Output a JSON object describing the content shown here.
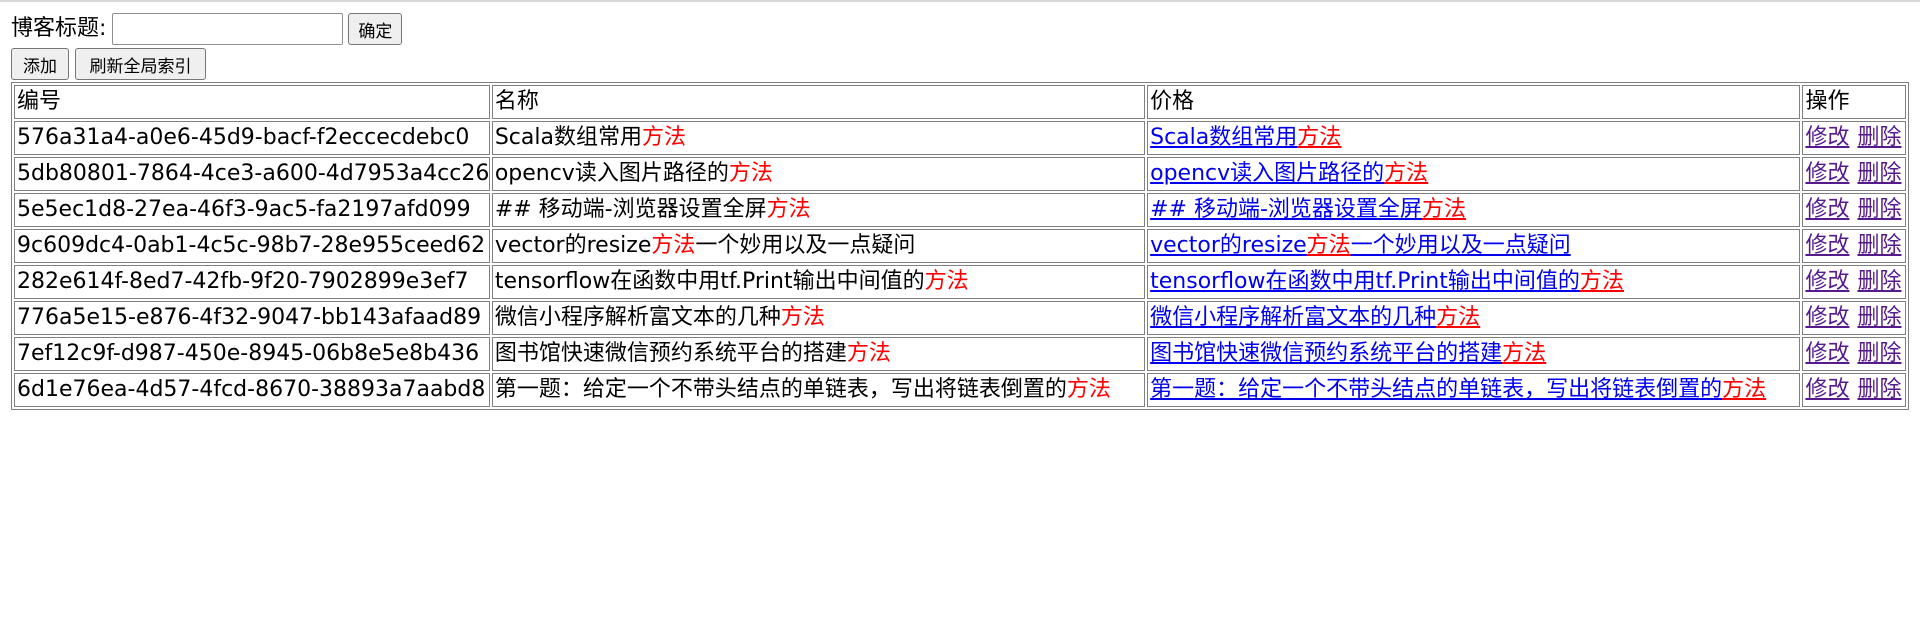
{
  "search": {
    "label": "博客标题:",
    "value": "",
    "placeholder": "",
    "confirm_label": "确定"
  },
  "toolbar": {
    "add_label": "添加",
    "refresh_label": "刷新全局索引"
  },
  "table": {
    "headers": [
      "编号",
      "名称",
      "价格",
      "操作"
    ],
    "rows": [
      {
        "id": "576a31a4-a0e6-45d9-bacf-f2eccecdebc0",
        "pre": "Scala数组常用",
        "hl": "方法",
        "post": ""
      },
      {
        "id": "5db80801-7864-4ce3-a600-4d7953a4cc26",
        "pre": "opencv读入图片路径的",
        "hl": "方法",
        "post": ""
      },
      {
        "id": "5e5ec1d8-27ea-46f3-9ac5-fa2197afd099",
        "pre": "## 移动端-浏览器设置全屏",
        "hl": "方法",
        "post": ""
      },
      {
        "id": "9c609dc4-0ab1-4c5c-98b7-28e955ceed62",
        "pre": "vector的resize",
        "hl": "方法",
        "post": "一个妙用以及一点疑问"
      },
      {
        "id": "282e614f-8ed7-42fb-9f20-7902899e3ef7",
        "pre": "tensorflow在函数中用tf.Print输出中间值的",
        "hl": "方法",
        "post": ""
      },
      {
        "id": "776a5e15-e876-4f32-9047-bb143afaad89",
        "pre": "微信小程序解析富文本的几种",
        "hl": "方法",
        "post": ""
      },
      {
        "id": "7ef12c9f-d987-450e-8945-06b8e5e8b436",
        "pre": "图书馆快速微信预约系统平台的搭建",
        "hl": "方法",
        "post": ""
      },
      {
        "id": "6d1e76ea-4d57-4fcd-8670-38893a7aabd8",
        "pre": "第一题：给定一个不带头结点的单链表，写出将链表倒置的",
        "hl": "方法",
        "post": ""
      }
    ],
    "edit_label": "修改",
    "delete_label": "删除"
  },
  "colors": {
    "highlight": "#ff0000",
    "link": "#0000ee",
    "visited_link": "#551a8b"
  }
}
